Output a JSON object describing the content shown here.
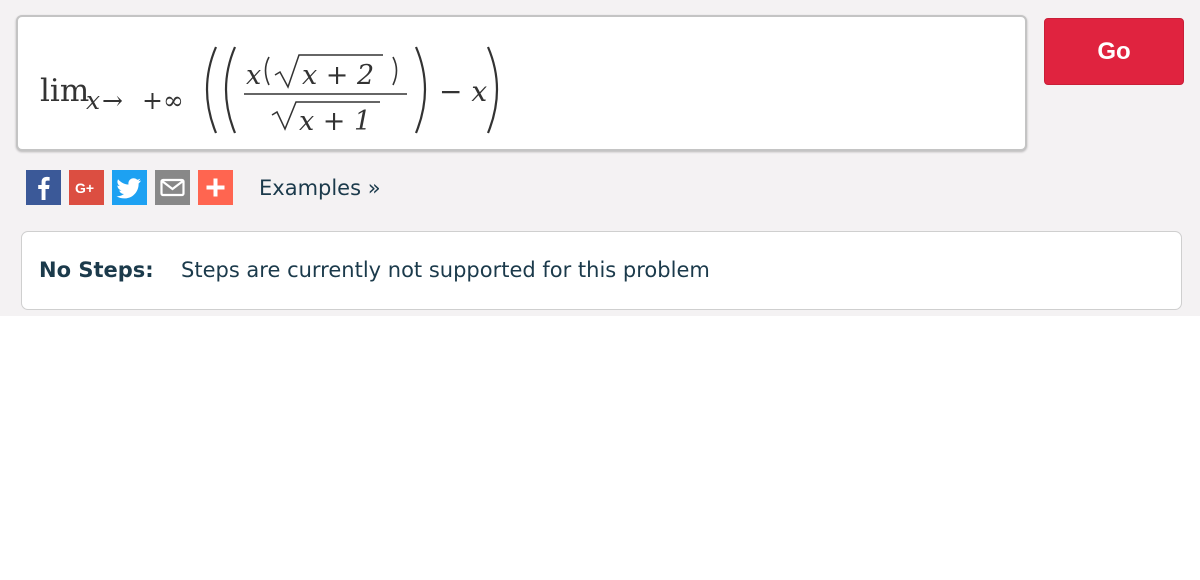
{
  "math_input": {
    "lim": "lim",
    "subscript_var": "x",
    "subscript_arrow": "→",
    "subscript_target": "+∞",
    "numerator_var": "x",
    "sqrt_numerator": "x + 2",
    "sqrt_denominator": "x + 1",
    "minus_term": "− x"
  },
  "go_button": {
    "label": "Go"
  },
  "share_bar": {
    "buttons": [
      {
        "icon": "facebook-icon",
        "glyph": "f",
        "color": "#3b5998"
      },
      {
        "icon": "google-plus-icon",
        "glyph": "G+",
        "color": "#dc4e41"
      },
      {
        "icon": "twitter-icon",
        "glyph": "twitter-bird",
        "color": "#1da1f2"
      },
      {
        "icon": "email-icon",
        "glyph": "envelope",
        "color": "#888888"
      },
      {
        "icon": "more-icon",
        "glyph": "+",
        "color": "#ff6550"
      }
    ]
  },
  "examples_link": {
    "label": "Examples »"
  },
  "steps": {
    "label": "No Steps:",
    "message": "Steps are currently not supported for this problem"
  }
}
